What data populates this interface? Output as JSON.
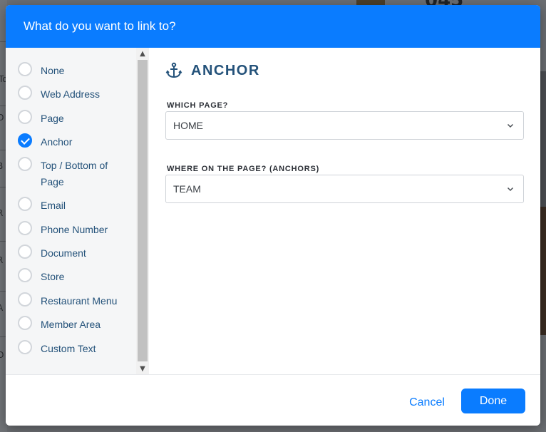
{
  "background": {
    "number_fragment": "045",
    "side_fragments": [
      "To",
      "O",
      "B",
      "R",
      "R",
      "A",
      "O"
    ]
  },
  "dialog": {
    "title": "What do you want to link to?",
    "link_types": [
      {
        "label": "None",
        "selected": false
      },
      {
        "label": "Web Address",
        "selected": false
      },
      {
        "label": "Page",
        "selected": false
      },
      {
        "label": "Anchor",
        "selected": true
      },
      {
        "label": "Top / Bottom of Page",
        "selected": false
      },
      {
        "label": "Email",
        "selected": false
      },
      {
        "label": "Phone Number",
        "selected": false
      },
      {
        "label": "Document",
        "selected": false
      },
      {
        "label": "Store",
        "selected": false
      },
      {
        "label": "Restaurant Menu",
        "selected": false
      },
      {
        "label": "Member Area",
        "selected": false
      },
      {
        "label": "Custom Text",
        "selected": false
      }
    ],
    "section": {
      "icon": "anchor-icon",
      "title": "ANCHOR"
    },
    "page_field": {
      "label": "WHICH PAGE?",
      "value": "HOME"
    },
    "anchor_field": {
      "label": "WHERE ON THE PAGE?",
      "hint": "(ANCHORS)",
      "value": "TEAM"
    },
    "cancel_label": "Cancel",
    "done_label": "Done"
  },
  "colors": {
    "accent": "#0a7cff",
    "label_text": "#24527a",
    "annotation_underline": "#e0171f"
  }
}
